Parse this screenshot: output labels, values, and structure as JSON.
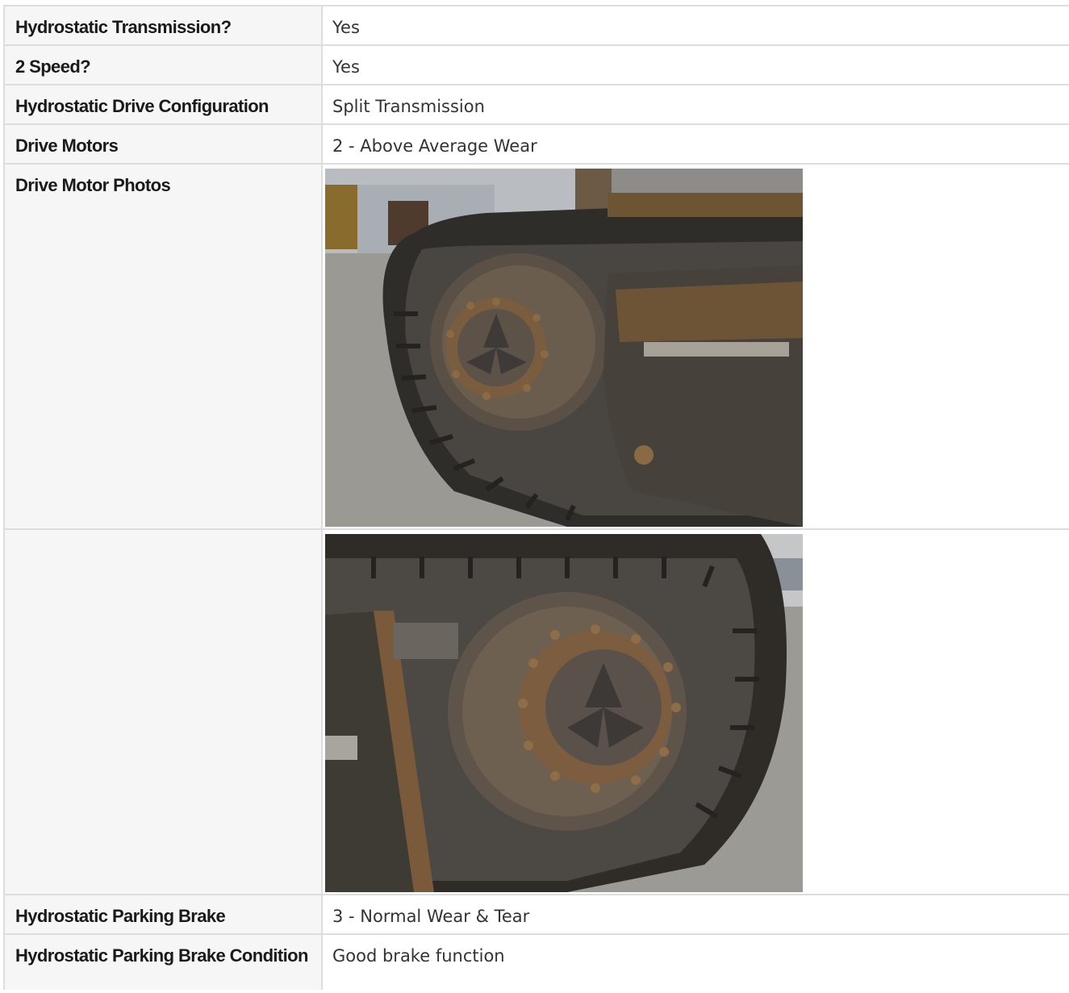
{
  "rows": [
    {
      "label": "Hydrostatic Transmission?",
      "value": "Yes"
    },
    {
      "label": "2 Speed?",
      "value": "Yes"
    },
    {
      "label": "Hydrostatic Drive Configuration",
      "value": "Split Transmission"
    },
    {
      "label": "Drive Motors",
      "value": "2 - Above Average Wear"
    },
    {
      "label": "Drive Motor Photos",
      "value": ""
    },
    {
      "label": "",
      "value": ""
    },
    {
      "label": "Hydrostatic Parking Brake",
      "value": "3 - Normal Wear & Tear"
    },
    {
      "label": "Hydrostatic Parking Brake Condition",
      "value": "Good brake function"
    }
  ],
  "photos": [
    {
      "name": "drive-motor-photo-1"
    },
    {
      "name": "drive-motor-photo-2"
    }
  ]
}
